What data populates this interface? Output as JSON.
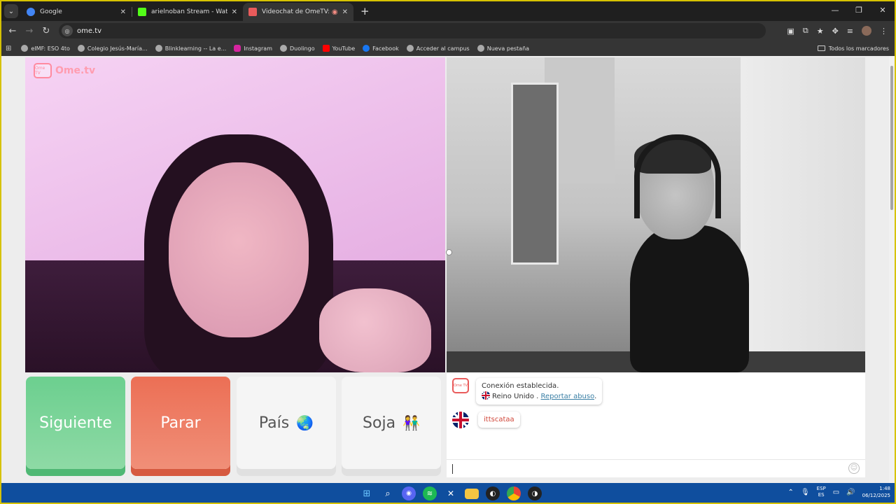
{
  "browser": {
    "tabs": [
      {
        "title": "Google",
        "favicon_color": "#4285f4"
      },
      {
        "title": "arielnoban Stream - Watch Live",
        "favicon_color": "#53fc18"
      },
      {
        "title": "Videochat de OmeTV: una",
        "favicon_color": "#e95b5b"
      }
    ],
    "url": "ome.tv",
    "bookmarks": [
      {
        "label": "eIMF: ESO 4to",
        "icon_color": "#aaaaaa"
      },
      {
        "label": "Colegio Jesús-María...",
        "icon_color": "#aaaaaa"
      },
      {
        "label": "Blinklearning -- La e...",
        "icon_color": "#aaaaaa"
      },
      {
        "label": "Instagram",
        "icon_color": "#d6249f"
      },
      {
        "label": "Duolingo",
        "icon_color": "#aaaaaa"
      },
      {
        "label": "YouTube",
        "icon_color": "#ff0000"
      },
      {
        "label": "Facebook",
        "icon_color": "#1877f2"
      },
      {
        "label": "Acceder al campus",
        "icon_color": "#aaaaaa"
      },
      {
        "label": "Nueva pestaña",
        "icon_color": "#aaaaaa"
      }
    ],
    "all_bookmarks": "Todos los marcadores"
  },
  "ometv": {
    "logo_box": "Ome TV",
    "logo_text": "Ome.tv",
    "buttons": {
      "next": "Siguiente",
      "stop": "Parar",
      "country": "País",
      "country_emoji": "🌏",
      "gender": "Soja",
      "gender_emoji": "👫"
    },
    "chat": {
      "system_line1": "Conexión establecida.",
      "system_country": "Reino Unido .",
      "report_link": "Reportar abuso",
      "report_suffix": ".",
      "partner_message": "ittscataa"
    }
  },
  "taskbar": {
    "lang_top": "ESP",
    "lang_bottom": "ES",
    "time": "1:48",
    "date": "06/12/2025"
  }
}
